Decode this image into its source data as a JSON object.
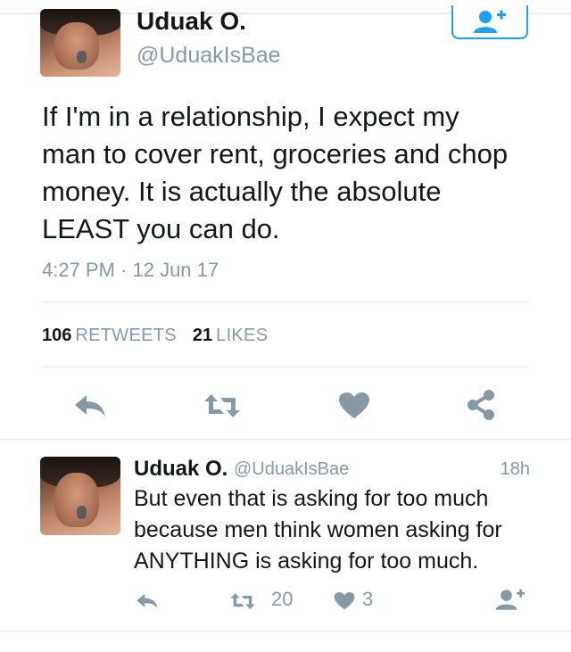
{
  "tweet": {
    "author_name": "Uduak O.",
    "author_handle": "@UduakIsBae",
    "text_lines": [
      "If I'm in a relationship, I expect my",
      "man to cover rent, groceries and chop",
      "money. It is actually the absolute",
      "LEAST you can do."
    ],
    "timestamp": "4:27 PM · 12 Jun 17",
    "retweets_count": "106",
    "retweets_label": "RETWEETS",
    "likes_count": "21",
    "likes_label": "LIKES",
    "icons": {
      "follow": "follow-user-icon",
      "reply": "reply-icon",
      "retweet": "retweet-icon",
      "like": "heart-icon",
      "share": "share-icon"
    }
  },
  "reply": {
    "author_name": "Uduak O.",
    "author_handle": "@UduakIsBae",
    "time": "18h",
    "text_lines": [
      "But even that is asking for too much",
      "because men think women asking for",
      "ANYTHING is asking for too much."
    ],
    "retweet_count": "20",
    "like_count": "3",
    "icons": {
      "reply": "reply-icon",
      "retweet": "retweet-icon",
      "like": "heart-icon",
      "follow": "follow-user-icon"
    }
  },
  "colors": {
    "accent": "#1da1f2",
    "icon_gray": "#8899a6",
    "text": "#14171a",
    "divider": "#e1e8ed"
  }
}
